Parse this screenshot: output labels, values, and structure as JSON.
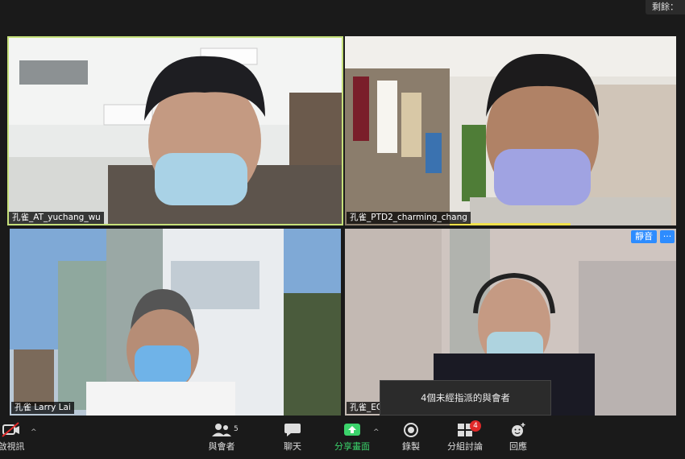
{
  "timer": {
    "label": "剩餘："
  },
  "participants": [
    {
      "name": "孔雀_AT_yuchang_wu",
      "active": true
    },
    {
      "name": "孔雀_PTD2_charming_chang",
      "active": false
    },
    {
      "name": "孔雀 Larry Lai",
      "active": false
    },
    {
      "name": "孔雀_EC",
      "active": false,
      "muted_badge": "靜音",
      "more_badge": "···"
    }
  ],
  "tooltip": {
    "text": "4個未經指派的與會者"
  },
  "toolbar": {
    "video": {
      "label": "啟視訊",
      "icon": "video-off-icon"
    },
    "participants": {
      "label": "與會者",
      "count": "5",
      "icon": "participants-icon"
    },
    "chat": {
      "label": "聊天",
      "icon": "chat-icon"
    },
    "share": {
      "label": "分享畫面",
      "icon": "share-screen-icon"
    },
    "record": {
      "label": "錄製",
      "icon": "record-icon"
    },
    "breakout": {
      "label": "分組討論",
      "badge": "4",
      "icon": "breakout-rooms-icon"
    },
    "reactions": {
      "label": "回應",
      "icon": "reactions-icon"
    }
  },
  "colors": {
    "accent_green": "#3bd36b",
    "active_border": "#c6e07a",
    "blue": "#2d8cff",
    "red_badge": "#e02828"
  }
}
